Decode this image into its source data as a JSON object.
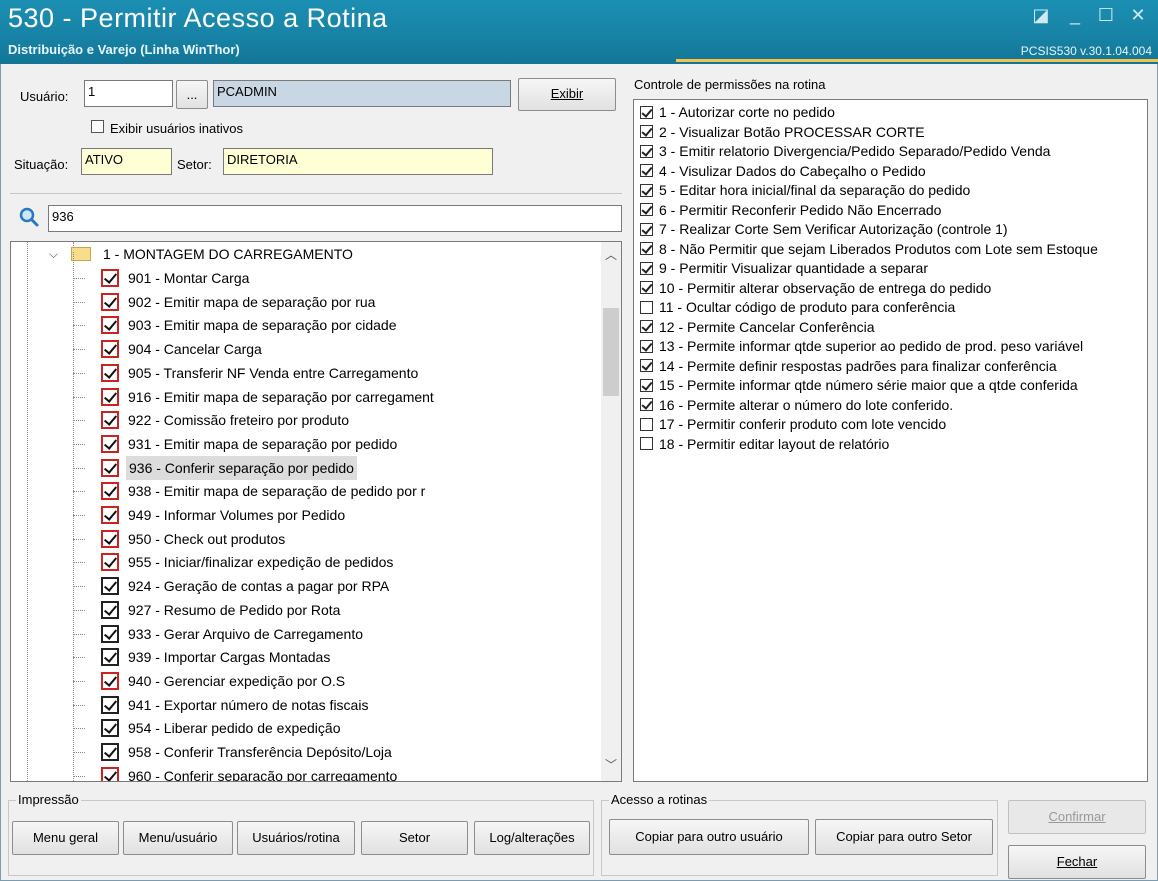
{
  "window": {
    "title": "530 - Permitir Acesso a Rotina",
    "subtitle": "Distribuição e Varejo (Linha WinThor)",
    "version": "PCSIS530  v.30.1.04.004"
  },
  "user": {
    "usuario_label": "Usuário:",
    "usuario_value": "1",
    "ellipsis_label": "...",
    "user_name": "PCADMIN",
    "exibir_label": "Exibir",
    "inativos_label": "Exibir usuários inativos",
    "situacao_label": "Situação:",
    "situacao_value": "ATIVO",
    "setor_label": "Setor:",
    "setor_value": "DIRETORIA"
  },
  "search": {
    "value": "936"
  },
  "tree": {
    "group_label": "1 - MONTAGEM DO CARREGAMENTO",
    "items": [
      {
        "label": "901 - Montar Carga",
        "style": "red"
      },
      {
        "label": "902 - Emitir mapa de separação por rua",
        "style": "red"
      },
      {
        "label": "903 - Emitir mapa de separação por cidade",
        "style": "red"
      },
      {
        "label": "904 - Cancelar Carga",
        "style": "red"
      },
      {
        "label": "905 - Transferir NF Venda entre Carregamento",
        "style": "red"
      },
      {
        "label": "916 - Emitir mapa de separação por carregament",
        "style": "red"
      },
      {
        "label": "922 - Comissão freteiro por produto",
        "style": "red"
      },
      {
        "label": "931 - Emitir mapa de separação por pedido",
        "style": "red"
      },
      {
        "label": "936 - Conferir separação por pedido",
        "style": "red",
        "selected": true
      },
      {
        "label": "938 - Emitir mapa de separação de pedido por r",
        "style": "red"
      },
      {
        "label": "949 - Informar Volumes por Pedido",
        "style": "red"
      },
      {
        "label": "950 - Check out produtos",
        "style": "red"
      },
      {
        "label": "955 - Iniciar/finalizar expedição de pedidos",
        "style": "red"
      },
      {
        "label": "924 - Geração de contas a pagar por RPA",
        "style": "black"
      },
      {
        "label": "927 - Resumo de Pedido por Rota",
        "style": "black"
      },
      {
        "label": "933 - Gerar Arquivo de Carregamento",
        "style": "black"
      },
      {
        "label": "939 - Importar Cargas Montadas",
        "style": "black"
      },
      {
        "label": "940 - Gerenciar expedição por O.S",
        "style": "red"
      },
      {
        "label": "941 - Exportar número de notas fiscais",
        "style": "black"
      },
      {
        "label": "954 - Liberar pedido de expedição",
        "style": "black"
      },
      {
        "label": "958 - Conferir Transferência Depósito/Loja",
        "style": "black"
      },
      {
        "label": "960 - Conferir separação por carregamento",
        "style": "red"
      }
    ]
  },
  "permissions": {
    "header": "Controle de permissões na rotina",
    "items": [
      {
        "label": "1 - Autorizar corte no pedido",
        "checked": true
      },
      {
        "label": "2 - Visualizar Botão PROCESSAR CORTE",
        "checked": true
      },
      {
        "label": "3 - Emitir relatorio Divergencia/Pedido Separado/Pedido Venda",
        "checked": true
      },
      {
        "label": "4 - Visulizar Dados do Cabeçalho o Pedido",
        "checked": true
      },
      {
        "label": "5 - Editar hora inicial/final da separação do pedido",
        "checked": true
      },
      {
        "label": "6 - Permitir Reconferir Pedido Não Encerrado",
        "checked": true
      },
      {
        "label": "7 - Realizar Corte Sem Verificar Autorização (controle 1)",
        "checked": true
      },
      {
        "label": "8 - Não Permitir que sejam Liberados Produtos com Lote sem Estoque",
        "checked": true
      },
      {
        "label": "9 - Permitir Visualizar quantidade a separar",
        "checked": true
      },
      {
        "label": "10 - Permitir alterar observação de entrega do pedido",
        "checked": true
      },
      {
        "label": "11 - Ocultar código de produto para conferência",
        "checked": false
      },
      {
        "label": "12 - Permite Cancelar Conferência",
        "checked": true
      },
      {
        "label": "13 - Permite informar qtde superior ao pedido de prod. peso variável",
        "checked": true
      },
      {
        "label": "14 - Permite definir respostas padrões para finalizar conferência",
        "checked": true
      },
      {
        "label": "15 - Permite informar qtde número série maior que a qtde conferida",
        "checked": true
      },
      {
        "label": "16 - Permite alterar o número do lote conferido.",
        "checked": true
      },
      {
        "label": "17 - Permitir conferir produto com lote vencido",
        "checked": false
      },
      {
        "label": "18 - Permitir editar layout de relatório",
        "checked": false
      }
    ]
  },
  "impressao": {
    "label": "Impressão",
    "menu_geral": "Menu geral",
    "menu_usuario": "Menu/usuário",
    "usuarios_rotina": "Usuários/rotina",
    "setor": "Setor",
    "log_alteracoes": "Log/alterações"
  },
  "acesso": {
    "label": "Acesso a rotinas",
    "copiar_usuario": "Copiar para outro usuário",
    "copiar_setor": "Copiar para outro Setor"
  },
  "actions": {
    "confirmar": "Confirmar",
    "fechar": "Fechar"
  }
}
